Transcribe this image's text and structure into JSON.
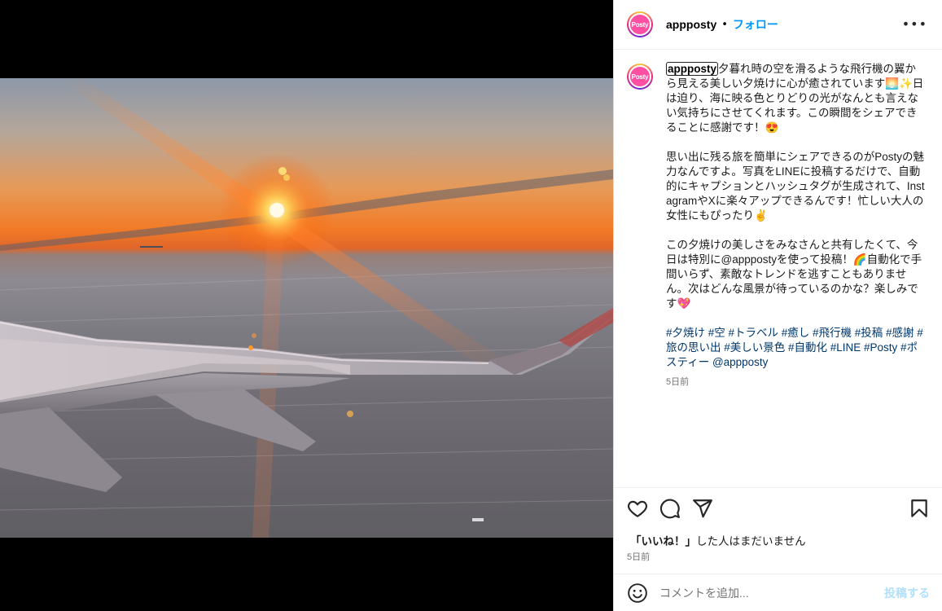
{
  "post": {
    "username": "appposty",
    "avatar_text": "Posty",
    "follow_label": "フォロー",
    "more_icon": "more-horizontal-icon"
  },
  "caption": {
    "username": "appposty",
    "text": "夕暮れ時の空を滑るような飛行機の翼から見える美しい夕焼けに心が癒されています🌅✨日は迫り、海に映る色とりどりの光がなんとも言えない気持ちにさせてくれます。この瞬間をシェアできることに感謝です！😍\n\n思い出に残る旅を簡単にシェアできるのがPostyの魅力なんですよ。写真をLINEに投稿するだけで、自動的にキャプションとハッシュタグが生成されて、InstagramやXに楽々アップできるんです！忙しい大人の女性にもぴったり✌\n\nこの夕焼けの美しさをみなさんと共有したくて、今日は特別に@apppostyを使って投稿！🌈自動化で手間いらず、素敵なトレンドを逃すこともありません。次はどんな風景が待っているのかな？楽しみです💖",
    "hashtags": "#夕焼け #空 #トラベル #癒し #飛行機 #投稿 #感謝 #旅の思い出 #美しい景色 #自動化 #LINE #Posty #ポスティー @appposty",
    "time": "5日前"
  },
  "actions": {
    "like_icon": "heart-icon",
    "comment_icon": "comment-icon",
    "share_icon": "send-icon",
    "save_icon": "bookmark-icon"
  },
  "likes_text_bold": "「いいね！」",
  "likes_text_rest": "した人はまだいません",
  "post_time": "5日前",
  "comment": {
    "placeholder": "コメントを追加...",
    "post_label": "投稿する",
    "emoji_icon": "emoji-icon"
  },
  "image": {
    "subject": "airplane-wing-sunset-photo"
  }
}
